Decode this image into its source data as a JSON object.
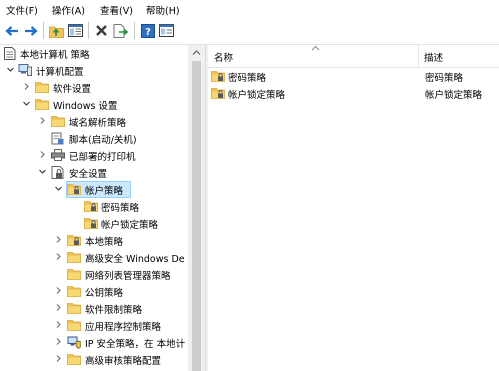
{
  "menu": [
    "文件(F)",
    "操作(A)",
    "查看(V)",
    "帮助(H)"
  ],
  "toolbar": {
    "buttons": [
      "back-icon",
      "forward-icon",
      "up-folder-icon",
      "console-tree-icon",
      "delete-icon",
      "export-list-icon",
      "help-icon",
      "properties-icon"
    ]
  },
  "tree": {
    "root": "本地计算机 策略",
    "computer_config": "计算机配置",
    "software_settings": "软件设置",
    "windows_settings": "Windows 设置",
    "dns_policy": "域名解析策略",
    "scripts": "脚本(启动/关机)",
    "printers": "已部署的打印机",
    "security_settings": "安全设置",
    "account_policies": "帐户策略",
    "password_policy": "密码策略",
    "lockout_policy": "帐户锁定策略",
    "local_policies": "本地策略",
    "firewall": "高级安全 Windows De",
    "network_list": "网络列表管理器策略",
    "public_key": "公钥策略",
    "software_restriction": "软件限制策略",
    "app_control": "应用程序控制策略",
    "ipsec": "IP 安全策略，在 本地计",
    "audit": "高级审核策略配置"
  },
  "list": {
    "columns": {
      "name": "名称",
      "desc": "描述"
    },
    "rows": [
      {
        "name": "密码策略",
        "desc": "密码策略"
      },
      {
        "name": "帐户锁定策略",
        "desc": "帐户锁定策略"
      }
    ]
  },
  "colors": {
    "selection": "#cce8ff",
    "folder": "#f2c55c",
    "folder_dark": "#dba93b"
  }
}
